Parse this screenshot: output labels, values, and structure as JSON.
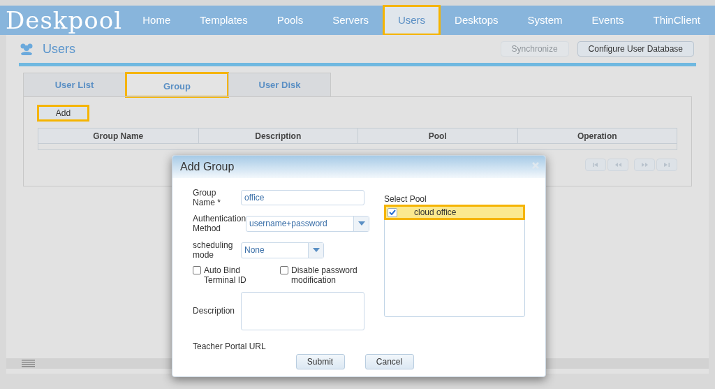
{
  "logo": "Deskpool",
  "nav": [
    {
      "label": "Home",
      "selected": false,
      "highlighted": false
    },
    {
      "label": "Templates",
      "selected": false,
      "highlighted": false
    },
    {
      "label": "Pools",
      "selected": false,
      "highlighted": false
    },
    {
      "label": "Servers",
      "selected": false,
      "highlighted": false
    },
    {
      "label": "Users",
      "selected": true,
      "highlighted": true
    },
    {
      "label": "Desktops",
      "selected": false,
      "highlighted": false
    },
    {
      "label": "System",
      "selected": false,
      "highlighted": false
    },
    {
      "label": "Events",
      "selected": false,
      "highlighted": false
    },
    {
      "label": "ThinClient",
      "selected": false,
      "highlighted": false
    }
  ],
  "page_title": "Users",
  "toolbar_buttons": [
    {
      "label": "Synchronize",
      "disabled": true
    },
    {
      "label": "Configure User Database",
      "disabled": false
    }
  ],
  "tabs": [
    {
      "label": "User List",
      "selected": false,
      "highlighted": false
    },
    {
      "label": "Group",
      "selected": true,
      "highlighted": true
    },
    {
      "label": "User Disk",
      "selected": false,
      "highlighted": false
    }
  ],
  "add_button": {
    "label": "Add",
    "highlighted": true
  },
  "table": {
    "columns": [
      "Group Name",
      "Description",
      "Pool",
      "Operation"
    ]
  },
  "dialog": {
    "title": "Add Group",
    "group_name": {
      "label": "Group Name",
      "required_mark": "*",
      "value": "office"
    },
    "auth_method": {
      "label": "Authentication Method",
      "value": "username+password"
    },
    "scheduling": {
      "label": "scheduling mode",
      "value": "None"
    },
    "checkboxes": [
      {
        "label": "Auto Bind Terminal ID",
        "checked": false
      },
      {
        "label": "Disable password modification",
        "checked": false
      }
    ],
    "description": {
      "label": "Description"
    },
    "teacher_portal": {
      "label": "Teacher Portal URL"
    },
    "pool_list": {
      "label": "Select Pool",
      "items": [
        {
          "label": "cloud office",
          "checked": true,
          "highlighted": true
        }
      ]
    },
    "buttons": [
      "Submit",
      "Cancel"
    ]
  }
}
